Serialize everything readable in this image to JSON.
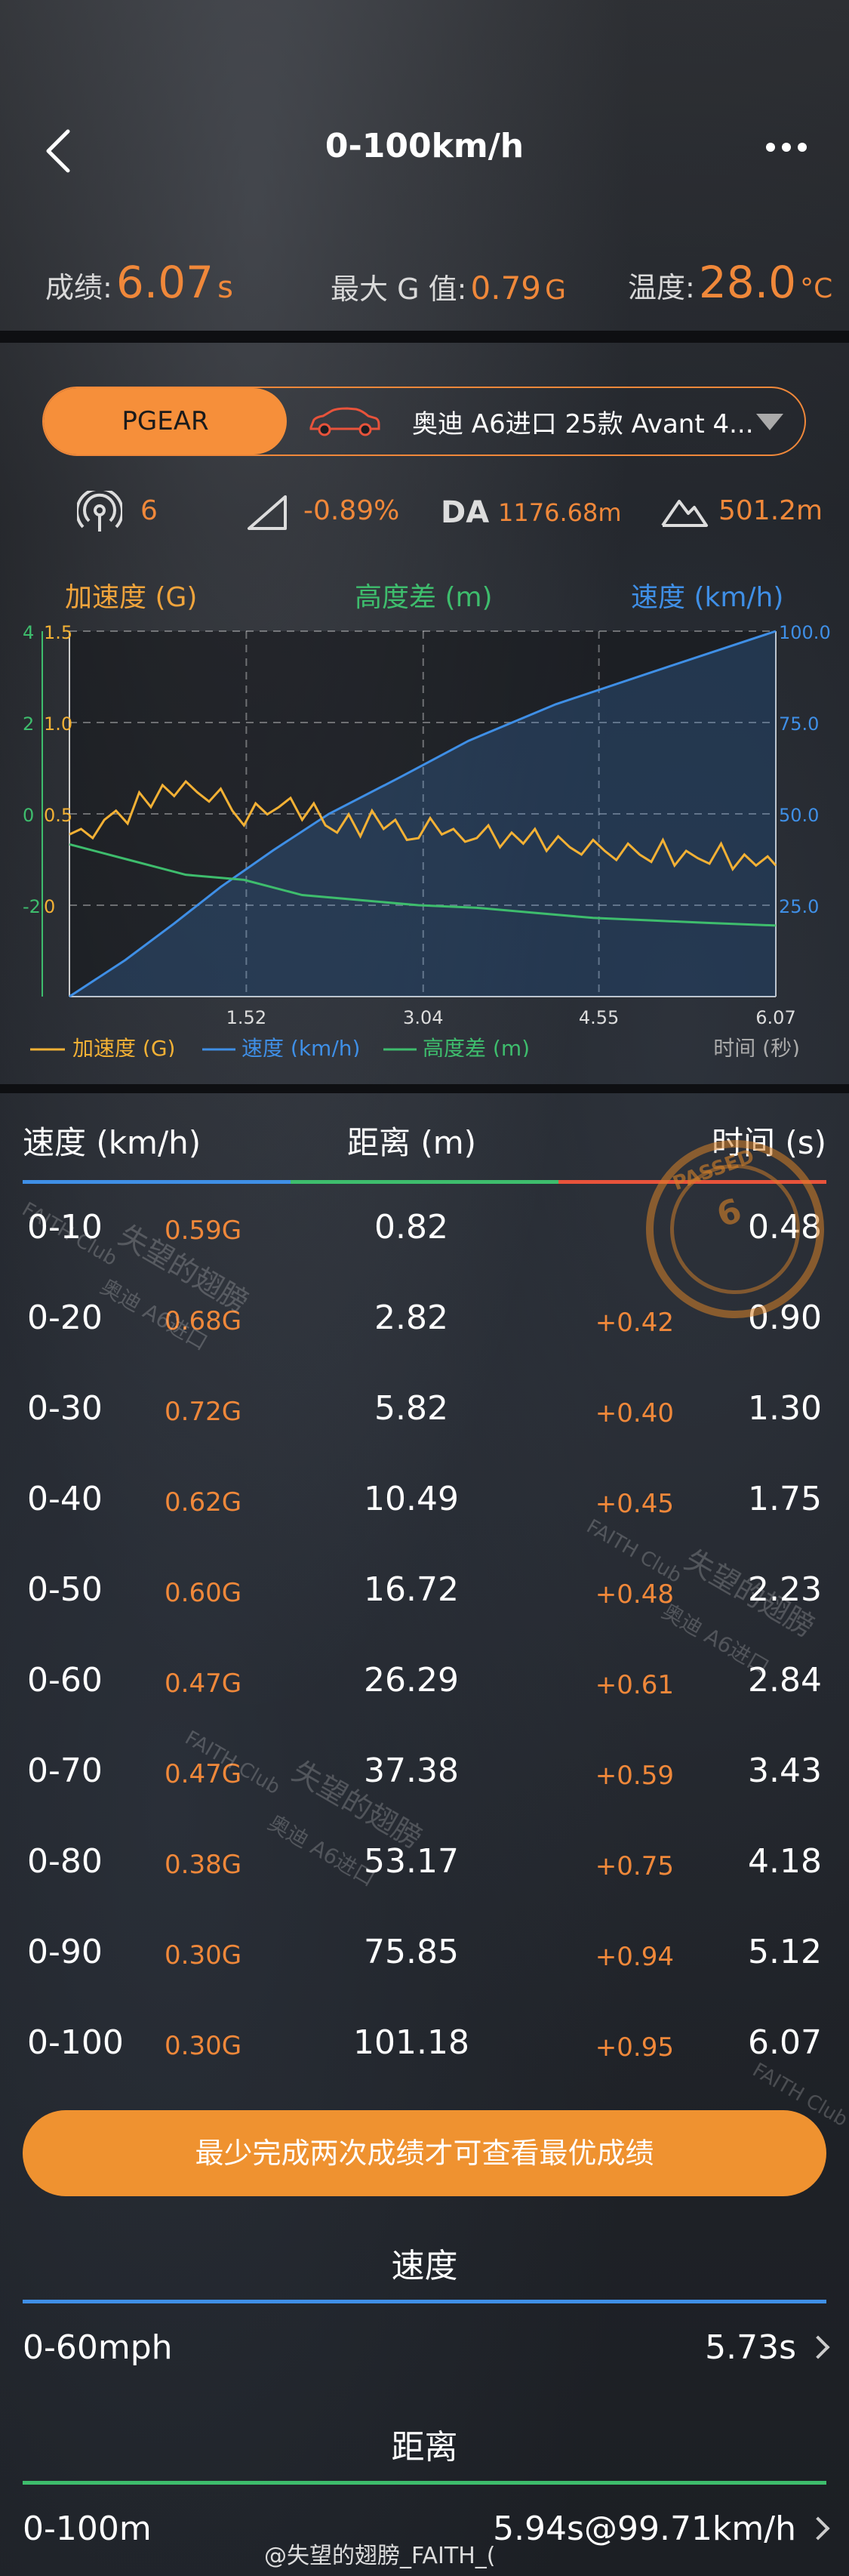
{
  "header": {
    "title": "0-100km/h"
  },
  "stats": {
    "score_label": "成绩:",
    "score_value": "6.07",
    "score_unit": "s",
    "g_label": "最大 G 值:",
    "g_value": "0.79",
    "g_unit": "G",
    "temp_label": "温度:",
    "temp_value": "28.0",
    "temp_unit": "°C"
  },
  "device": {
    "brand": "PGEAR",
    "car": "奥迪 A6进口 25款 Avant 4..."
  },
  "indicators": {
    "satellites": "6",
    "slope": "-0.89%",
    "da_label": "DA",
    "da_value": "1176.68m",
    "altitude": "501.2m"
  },
  "chart_data": {
    "type": "line",
    "headers": {
      "left": "加速度 (G)",
      "middle": "高度差 (m)",
      "right": "速度 (km/h)"
    },
    "x_ticks": [
      "1.52",
      "3.04",
      "4.55",
      "6.07"
    ],
    "x_axis_label": "时间 (秒)",
    "left_ticks_accel": [
      "1.5",
      "1.0",
      "0.5",
      "0"
    ],
    "left_ticks_alt": [
      "4",
      "2",
      "0",
      "-2"
    ],
    "right_ticks": [
      "100.0",
      "75.0",
      "50.0",
      "25.0"
    ],
    "xlim": [
      0,
      6.07
    ],
    "legend": [
      "加速度 (G)",
      "速度 (km/h)",
      "高度差 (m)"
    ],
    "colors": {
      "accel": "#f3b135",
      "speed": "#3f8fe6",
      "alt": "#3ebd6d"
    },
    "series": [
      {
        "name": "速度 (km/h)",
        "axis": "right",
        "x": [
          0,
          0.48,
          0.9,
          1.3,
          1.75,
          2.23,
          2.84,
          3.43,
          4.18,
          5.12,
          6.07
        ],
        "values": [
          0,
          10,
          20,
          30,
          40,
          50,
          60,
          70,
          80,
          90,
          100
        ]
      },
      {
        "name": "加速度 (G)",
        "axis": "left",
        "x": [
          0,
          0.1,
          0.2,
          0.3,
          0.4,
          0.5,
          0.6,
          0.7,
          0.8,
          0.9,
          1.0,
          1.1,
          1.2,
          1.3,
          1.4,
          1.5,
          1.6,
          1.7,
          1.8,
          1.9,
          2.0,
          2.1,
          2.2,
          2.3,
          2.4,
          2.5,
          2.6,
          2.7,
          2.8,
          2.9,
          3.0,
          3.1,
          3.2,
          3.3,
          3.4,
          3.5,
          3.6,
          3.7,
          3.8,
          3.9,
          4.0,
          4.1,
          4.2,
          4.3,
          4.4,
          4.5,
          4.6,
          4.7,
          4.8,
          4.9,
          5.0,
          5.1,
          5.2,
          5.3,
          5.4,
          5.5,
          5.6,
          5.7,
          5.8,
          5.9,
          6.0,
          6.07
        ],
        "values": [
          0.47,
          0.5,
          0.45,
          0.55,
          0.6,
          0.53,
          0.7,
          0.62,
          0.74,
          0.68,
          0.76,
          0.7,
          0.65,
          0.72,
          0.6,
          0.52,
          0.64,
          0.58,
          0.62,
          0.67,
          0.55,
          0.64,
          0.52,
          0.48,
          0.58,
          0.46,
          0.6,
          0.5,
          0.55,
          0.44,
          0.45,
          0.56,
          0.47,
          0.5,
          0.43,
          0.45,
          0.52,
          0.4,
          0.48,
          0.42,
          0.5,
          0.38,
          0.46,
          0.4,
          0.36,
          0.44,
          0.38,
          0.33,
          0.42,
          0.36,
          0.32,
          0.44,
          0.3,
          0.38,
          0.34,
          0.31,
          0.42,
          0.28,
          0.36,
          0.3,
          0.35,
          0.3
        ]
      },
      {
        "name": "高度差 (m)",
        "axis": "left-alt",
        "x": [
          0,
          0.5,
          1.0,
          1.5,
          2.0,
          2.5,
          3.0,
          3.5,
          4.0,
          4.5,
          5.0,
          5.5,
          6.07
        ],
        "values": [
          0,
          -0.3,
          -0.6,
          -0.7,
          -1.0,
          -1.1,
          -1.2,
          -1.25,
          -1.35,
          -1.45,
          -1.5,
          -1.55,
          -1.6
        ]
      }
    ]
  },
  "table": {
    "headers": {
      "speed": "速度 (km/h)",
      "distance": "距离 (m)",
      "time": "时间 (s)"
    },
    "rows": [
      {
        "speed": "0-10",
        "g": "0.59G",
        "distance": "0.82",
        "delta": "",
        "time": "0.48"
      },
      {
        "speed": "0-20",
        "g": "0.68G",
        "distance": "2.82",
        "delta": "+0.42",
        "time": "0.90"
      },
      {
        "speed": "0-30",
        "g": "0.72G",
        "distance": "5.82",
        "delta": "+0.40",
        "time": "1.30"
      },
      {
        "speed": "0-40",
        "g": "0.62G",
        "distance": "10.49",
        "delta": "+0.45",
        "time": "1.75"
      },
      {
        "speed": "0-50",
        "g": "0.60G",
        "distance": "16.72",
        "delta": "+0.48",
        "time": "2.23"
      },
      {
        "speed": "0-60",
        "g": "0.47G",
        "distance": "26.29",
        "delta": "+0.61",
        "time": "2.84"
      },
      {
        "speed": "0-70",
        "g": "0.47G",
        "distance": "37.38",
        "delta": "+0.59",
        "time": "3.43"
      },
      {
        "speed": "0-80",
        "g": "0.38G",
        "distance": "53.17",
        "delta": "+0.75",
        "time": "4.18"
      },
      {
        "speed": "0-90",
        "g": "0.30G",
        "distance": "75.85",
        "delta": "+0.94",
        "time": "5.12"
      },
      {
        "speed": "0-100",
        "g": "0.30G",
        "distance": "101.18",
        "delta": "+0.95",
        "time": "6.07"
      }
    ]
  },
  "best_button": "最少完成两次成绩才可查看最优成绩",
  "sections": {
    "speed_title": "速度",
    "speed_row": {
      "label": "0-60mph",
      "value": "5.73s"
    },
    "distance_title": "距离",
    "distance_row": {
      "label": "0-100m",
      "value": "5.94s@99.71km/h"
    }
  },
  "stamp": {
    "text": "PASSED",
    "number": "6"
  },
  "watermarks": {
    "club": "FAITH Club",
    "author": "失望的翅膀",
    "car": "奥迪 A6进口"
  },
  "footer_watermark": "@失望的翅膀_FAITH_("
}
